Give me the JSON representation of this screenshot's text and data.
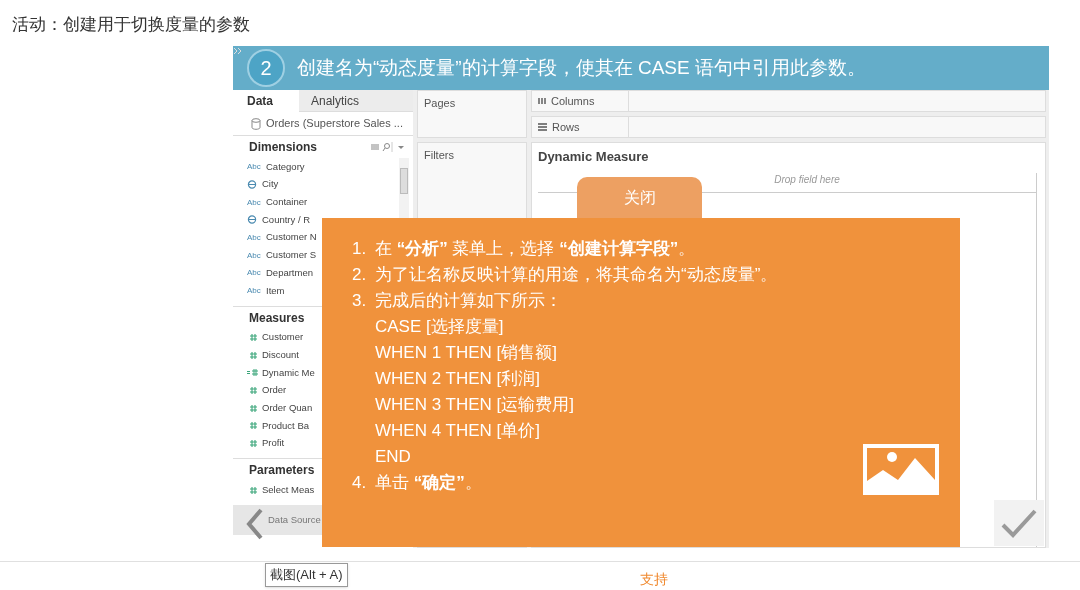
{
  "page_title": "活动：创建用于切换度量的参数",
  "slide": {
    "step": "2",
    "heading": "创建名为“动态度量”的计算字段，使其在 CASE 语句中引用此参数。",
    "data_pane": {
      "tabs": [
        {
          "label": "Data",
          "selected": true
        },
        {
          "label": "Analytics",
          "selected": false
        }
      ],
      "data_source": "Orders (Superstore Sales ...",
      "sections": [
        {
          "title": "Dimensions",
          "has_tools": true,
          "fields": [
            {
              "kind": "string",
              "icon": "Abc",
              "label": "Category"
            },
            {
              "kind": "geo",
              "label": "City"
            },
            {
              "kind": "string",
              "icon": "Abc",
              "label": "Container"
            },
            {
              "kind": "geo",
              "label": "Country / R"
            },
            {
              "kind": "string",
              "icon": "Abc",
              "label": "Customer N"
            },
            {
              "kind": "string",
              "icon": "Abc",
              "label": "Customer S"
            },
            {
              "kind": "string",
              "icon": "Abc",
              "label": "Departmen"
            },
            {
              "kind": "string",
              "icon": "Abc",
              "label": "Item"
            }
          ]
        },
        {
          "title": "Measures",
          "fields": [
            {
              "kind": "measure",
              "label": "Customer"
            },
            {
              "kind": "measure",
              "label": "Discount"
            },
            {
              "kind": "calc",
              "label": "Dynamic Me"
            },
            {
              "kind": "measure",
              "label": "Order"
            },
            {
              "kind": "measure",
              "label": "Order Quan"
            },
            {
              "kind": "measure",
              "label": "Product Ba"
            },
            {
              "kind": "measure",
              "label": "Profit"
            }
          ]
        },
        {
          "title": "Parameters",
          "fields": [
            {
              "kind": "measure",
              "label": "Select Meas"
            }
          ]
        }
      ],
      "footer_tab": "Data Source"
    },
    "shelves": [
      {
        "label": "Pages"
      },
      {
        "label": "Filters"
      }
    ],
    "columns_shelf": "Columns",
    "rows_shelf": "Rows",
    "sheet_title": "Dynamic Measure",
    "drop_hint": "Drop field here"
  },
  "popup": {
    "close_tab": "关闭",
    "lines": [
      {
        "kind": "step",
        "number": "1.",
        "text": "在 **“分析”** 菜单上，选择 **“创建计算字段”**。"
      },
      {
        "kind": "step",
        "number": "2.",
        "text": "为了让名称反映计算的用途，将其命名为“动态度量”。"
      },
      {
        "kind": "step",
        "number": "3.",
        "text": "完成后的计算如下所示："
      },
      {
        "kind": "code",
        "text": "CASE [选择度量]"
      },
      {
        "kind": "code",
        "text": "WHEN 1 THEN [销售额]"
      },
      {
        "kind": "code",
        "text": "WHEN 2 THEN [利润]"
      },
      {
        "kind": "code",
        "text": "WHEN 3 THEN [运输费用]"
      },
      {
        "kind": "code",
        "text": "WHEN 4 THEN [单价]"
      },
      {
        "kind": "code",
        "text": "END"
      },
      {
        "kind": "step",
        "number": "4.",
        "text": "单击 **“确定”**。"
      }
    ]
  },
  "footer": {
    "tooltip": "截图(Alt + A)",
    "link": "支持"
  }
}
